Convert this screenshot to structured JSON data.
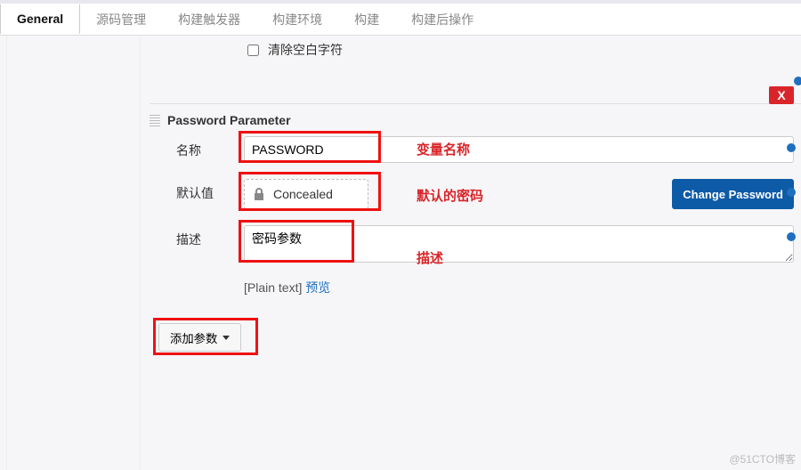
{
  "tabs": {
    "active": "General",
    "items": [
      "General",
      "源码管理",
      "构建触发器",
      "构建环境",
      "构建",
      "构建后操作"
    ]
  },
  "clear_whitespace": {
    "label": "清除空白字符",
    "checked": false
  },
  "param": {
    "section_title": "Password Parameter",
    "close_label": "X",
    "name_label": "名称",
    "name_value": "PASSWORD",
    "default_label": "默认值",
    "concealed_text": "Concealed",
    "change_password_label": "Change Password",
    "desc_label": "描述",
    "desc_value": "密码参数",
    "plain_text_label": "[Plain text]",
    "preview_label": "预览"
  },
  "annotations": {
    "name": "变量名称",
    "default": "默认的密码",
    "desc": "描述"
  },
  "add_param_label": "添加参数",
  "watermark": "@51CTO博客"
}
